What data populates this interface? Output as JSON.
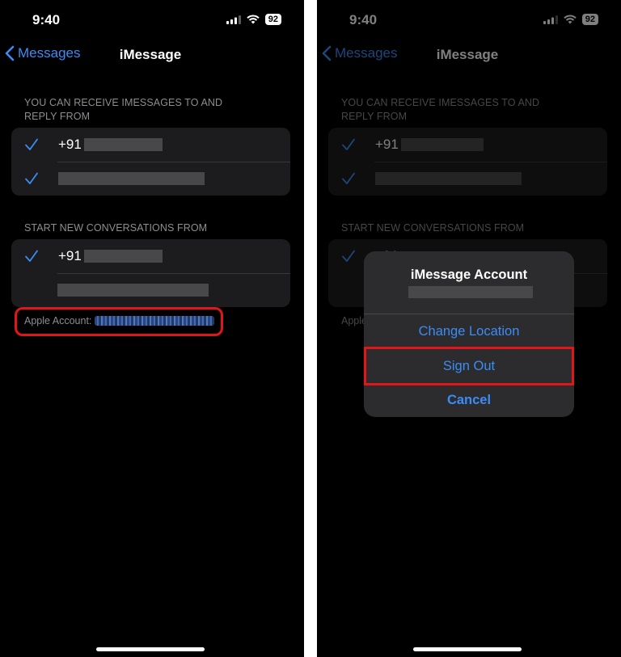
{
  "status_bar": {
    "time": "9:40",
    "battery": "92"
  },
  "nav": {
    "back_label": "Messages",
    "title": "iMessage"
  },
  "receive_section": {
    "header": "YOU CAN RECEIVE IMESSAGES TO AND REPLY FROM",
    "rows": [
      {
        "prefix": "+91",
        "checked": true
      },
      {
        "prefix": "",
        "checked": true
      }
    ]
  },
  "start_section": {
    "header": "START NEW CONVERSATIONS FROM",
    "rows": [
      {
        "prefix": "+91",
        "checked": true
      },
      {
        "prefix": "",
        "checked": false
      }
    ]
  },
  "apple_account": {
    "label": "Apple Account:"
  },
  "action_sheet": {
    "title": "iMessage Account",
    "change_location": "Change Location",
    "sign_out": "Sign Out",
    "cancel": "Cancel"
  },
  "colors": {
    "accent": "#3c8cf5",
    "highlight": "#e0161b",
    "background": "#000000",
    "group": "#1c1c1e"
  },
  "icons": [
    "chevron-left-icon",
    "checkmark-icon",
    "signal-icon",
    "wifi-icon",
    "battery-icon"
  ]
}
